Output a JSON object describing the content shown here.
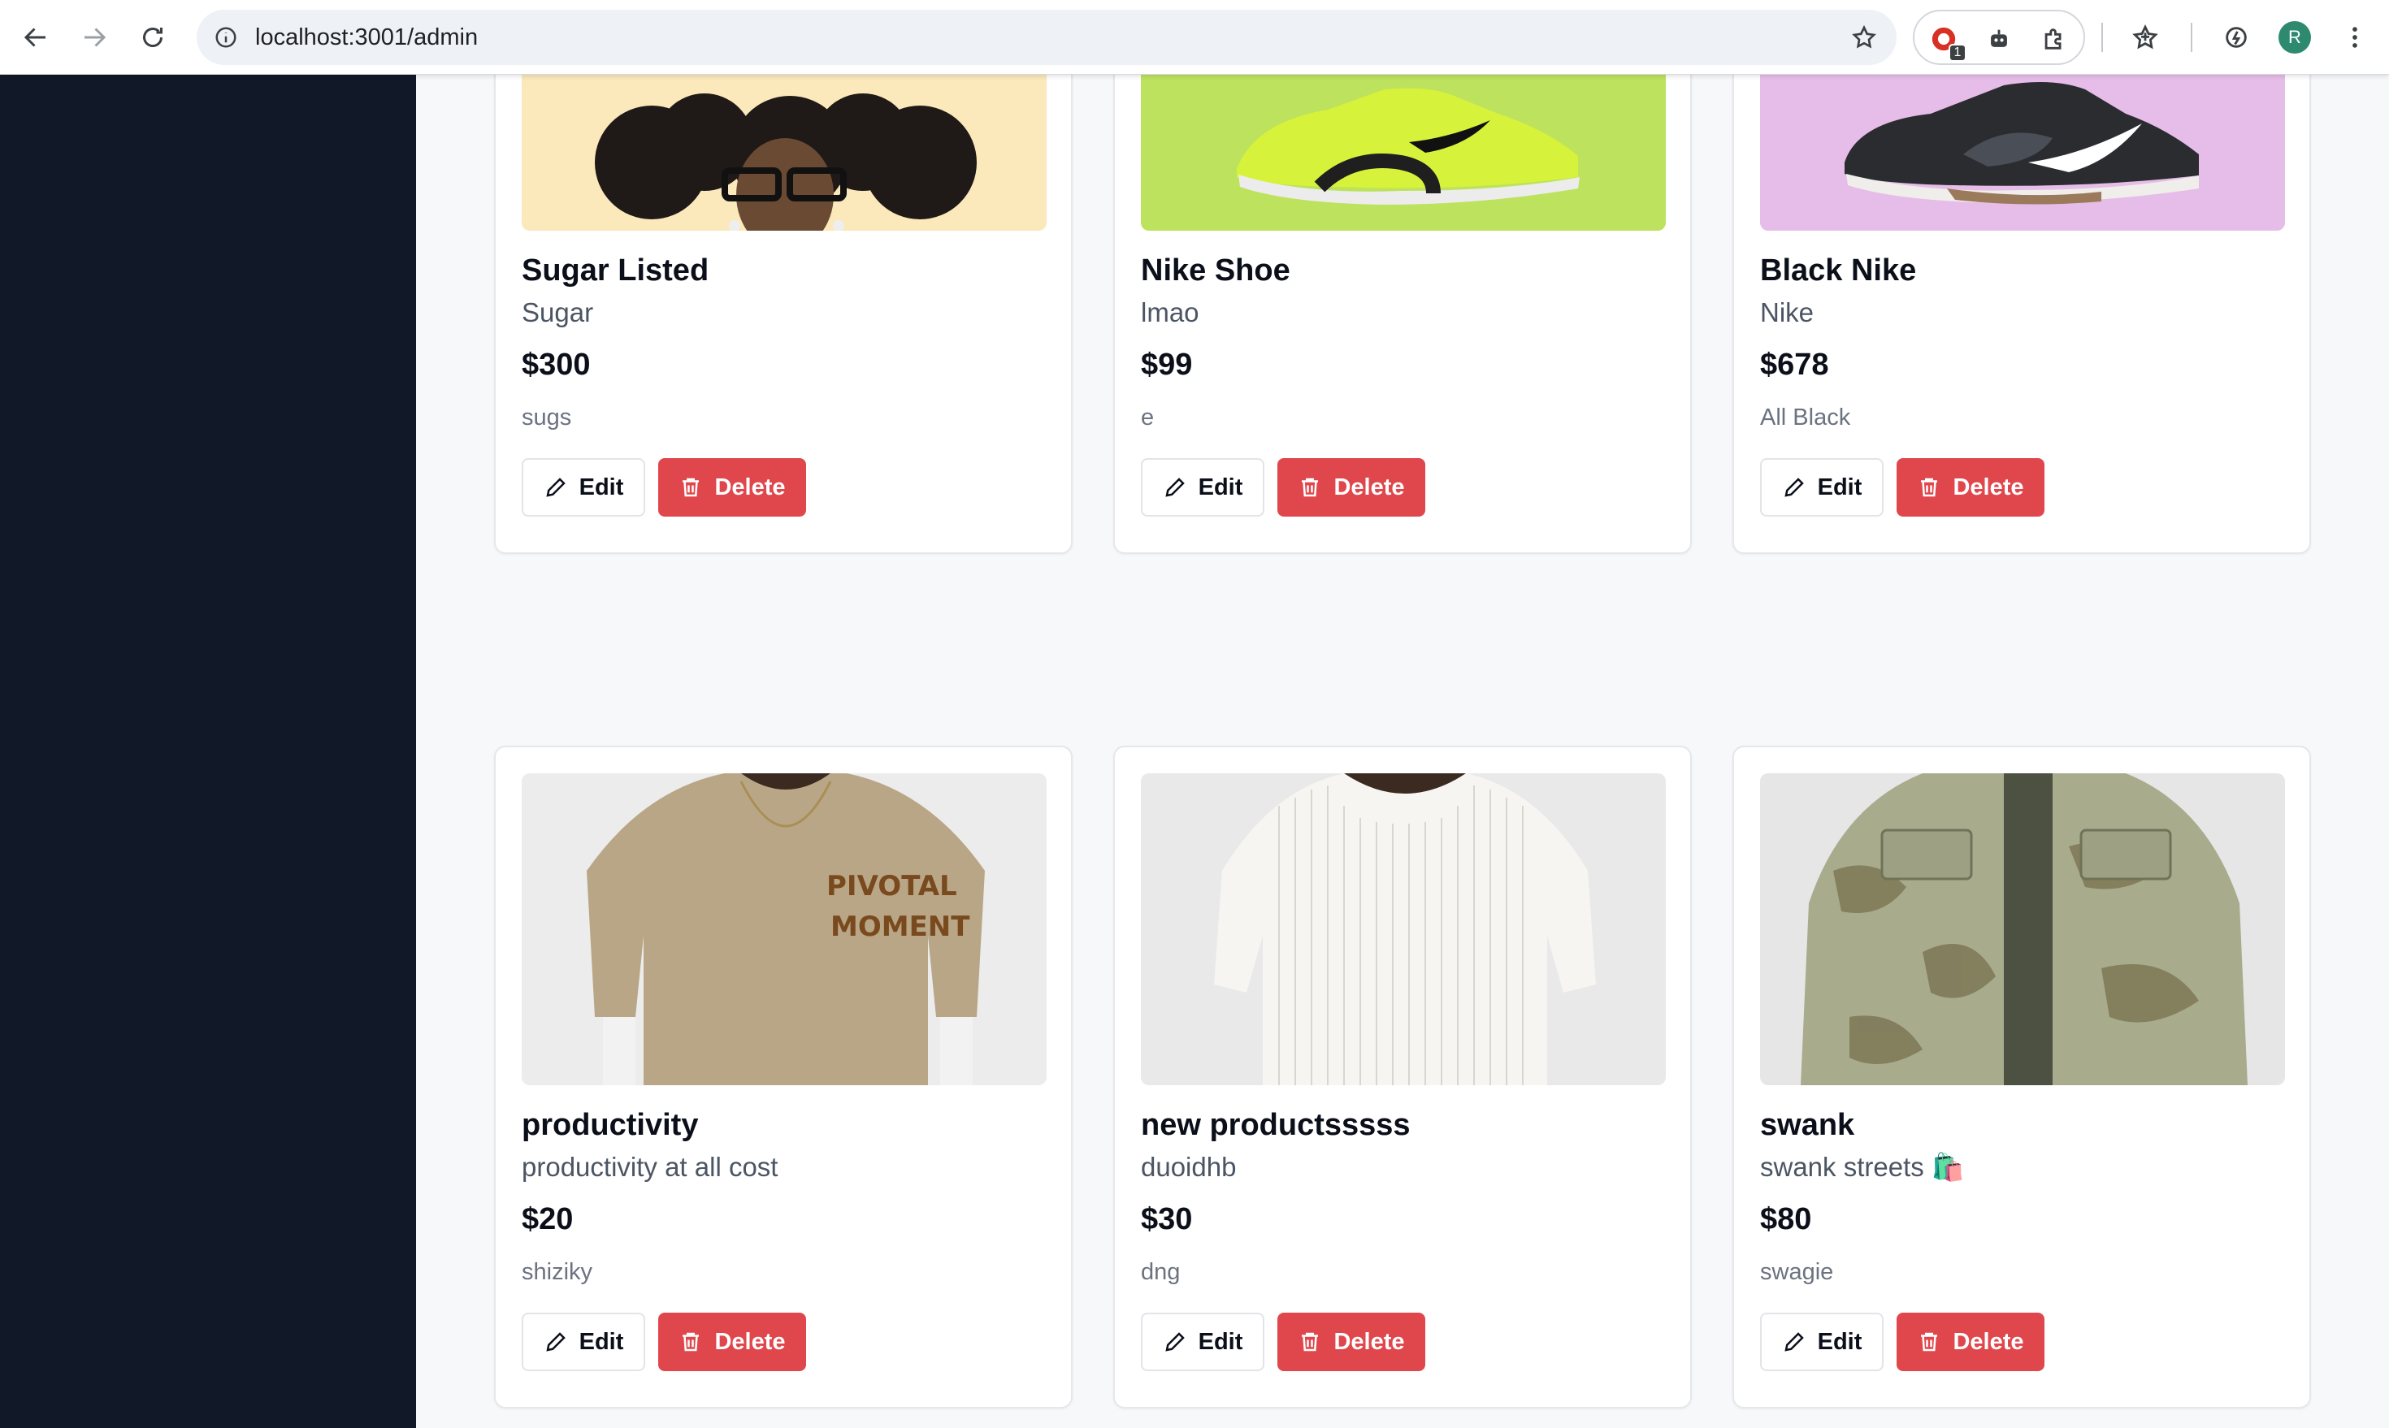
{
  "browser": {
    "url": "localhost:3001/admin",
    "extension_badge": "1",
    "profile_initial": "R"
  },
  "products": [
    {
      "title": "Sugar Listed",
      "subtitle": "Sugar",
      "price": "$300",
      "description": "sugs",
      "image": "cartoon-portrait",
      "bg": "#fbe8bb"
    },
    {
      "title": "Nike Shoe",
      "subtitle": "lmao",
      "price": "$99",
      "description": "e",
      "image": "lime-sneaker",
      "bg": "#bde25e"
    },
    {
      "title": "Black Nike",
      "subtitle": "Nike",
      "price": "$678",
      "description": "All Black",
      "image": "black-sneaker",
      "bg": "#e6bde8"
    },
    {
      "title": "productivity",
      "subtitle": "productivity at all cost",
      "price": "$20",
      "description": "shiziky",
      "image": "beige-tshirt",
      "bg": "#ececec"
    },
    {
      "title": "new productsssss",
      "subtitle": "duoidhb",
      "price": "$30",
      "description": "dng",
      "image": "white-tshirt",
      "bg": "#e9e9e9"
    },
    {
      "title": "swank",
      "subtitle": "swank streets 🛍️",
      "price": "$80",
      "description": "swagie",
      "image": "camo-jacket",
      "bg": "#e6e6e6"
    }
  ],
  "labels": {
    "edit": "Edit",
    "delete": "Delete"
  },
  "colors": {
    "sidebar": "#111827",
    "delete": "#e0474c"
  }
}
